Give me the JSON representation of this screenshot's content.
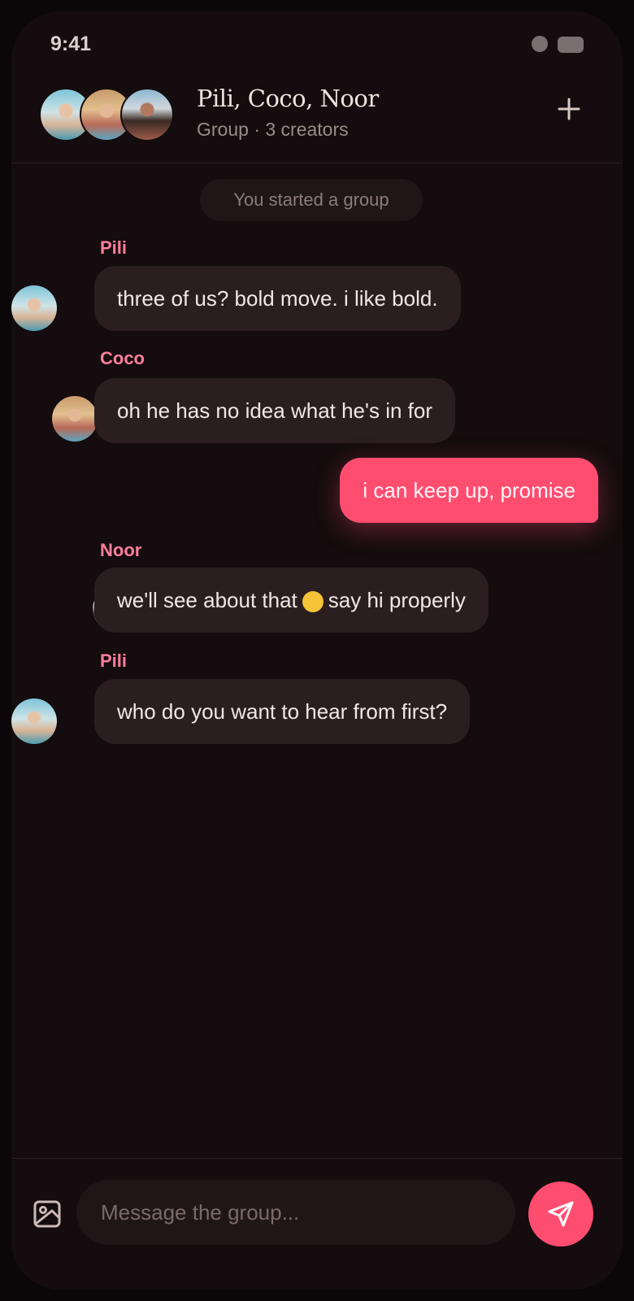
{
  "status_bar": {
    "time": "9:41"
  },
  "header": {
    "title": "Pili, Coco, Noor",
    "subtitle": "Group · 3 creators",
    "avatars": [
      "Pili",
      "Coco",
      "Noor"
    ],
    "add_icon": "plus-icon"
  },
  "chat": {
    "system_message": "You started a group",
    "messages": [
      {
        "sender": "Pili",
        "text": "three of us? bold move. i like bold.",
        "from_me": false
      },
      {
        "sender": "Coco",
        "text": "oh he has no idea what he's in for",
        "from_me": false
      },
      {
        "sender": "",
        "text": "i can keep up, promise",
        "from_me": true
      },
      {
        "sender": "Noor",
        "text_before": "we'll see about that",
        "emoji": "smirking-face",
        "text_after": "say hi properly",
        "from_me": false
      },
      {
        "sender": "Pili",
        "text": "who do you want to hear from first?",
        "from_me": false
      }
    ]
  },
  "composer": {
    "placeholder": "Message the group...",
    "image_icon": "image-icon",
    "send_icon": "send-icon"
  },
  "colors": {
    "accent": "#ff4d70",
    "sender_name": "#ff7e9c",
    "background": "#140c0e",
    "bubble": "#2a1e21"
  }
}
